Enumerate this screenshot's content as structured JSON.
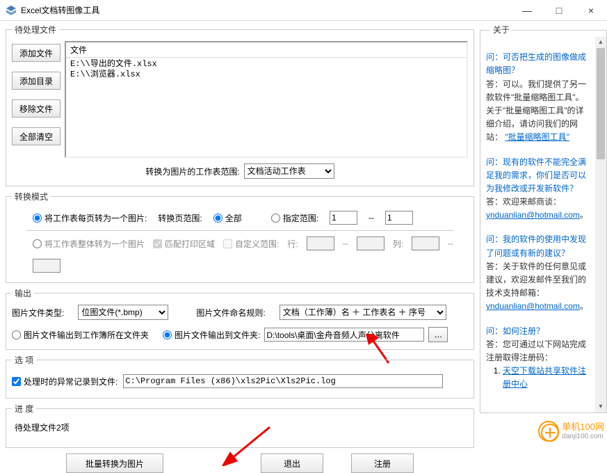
{
  "window": {
    "title": "Excel文档转图像工具",
    "minimize": "—",
    "maximize": "□",
    "close": "×"
  },
  "pending": {
    "legend": "待处理文件",
    "add_file": "添加文件",
    "add_dir": "添加目录",
    "remove": "移除文件",
    "clear": "全部清空",
    "col_header": "文件",
    "rows": [
      "E:\\\\导出的文件.xlsx",
      "E:\\\\浏览器.xlsx"
    ],
    "range_label": "转换为图片的工作表范围:",
    "range_value": "文档活动工作表"
  },
  "mode": {
    "legend": "转换模式",
    "per_page": "将工作表每页转为一个图片:",
    "page_range_label": "转换页范围:",
    "opt_all": "全部",
    "opt_range": "指定范围:",
    "range_from": "1",
    "range_dash": "--",
    "range_to": "1",
    "whole_sheet": "将工作表整体转为一个图片",
    "match_print": "匹配打印区域",
    "custom_range": "自定义范围:",
    "row_label": "行:",
    "col_label": "列:",
    "r1": "",
    "r2": "",
    "c1": "",
    "c2": ""
  },
  "output": {
    "legend": "输出",
    "filetype_label": "图片文件类型:",
    "filetype_value": "位图文件(*.bmp)",
    "naming_label": "图片文件命名规则:",
    "naming_value": "文档（工作薄）名 ＋ 工作表名 ＋ 序号",
    "to_workbook_dir": "图片文件输出到工作簿所在文件夹",
    "to_folder": "图片文件输出到文件夹:",
    "folder_path": "D:\\tools\\桌面\\金舟音频人声分离软件",
    "browse": "..."
  },
  "options": {
    "legend": "选  项",
    "log_label": "处理时的异常记录到文件:",
    "log_path": "C:\\Program Files (x86)\\xls2Pic\\Xls2Pic.log"
  },
  "progress": {
    "legend": "进  度",
    "text": "待处理文件2项"
  },
  "buttons": {
    "convert": "批量转换为图片",
    "exit": "退出",
    "register": "注册"
  },
  "about": {
    "legend": "关于",
    "q1": "问：可否把生成的图像做成缩略图？",
    "a1a": "答：可以。我们提供了另一款软件\"批量缩略图工具\"。 关于\"批量缩略图工具\"的详细介绍，请访问我们的网站：",
    "a1_link": "\"批量缩略图工具\"",
    "q2": "问：现有的软件不能完全满足我的需求，你们是否可以为我修改或开发新软件？",
    "a2a": "答：欢迎来邮商谈：",
    "a2_link": "ynduanlian@hotmail.com",
    "q3": "问：我的软件的使用中发现了问题或有新的建议？",
    "a3a": "答：关于软件的任何意见或建议，欢迎发邮件至我们的技术支持邮箱：",
    "a3_link": "ynduanlian@hotmail.com",
    "q4": "问：如何注册？",
    "a4a": "答：您可通过以下网站完成注册取得注册码：",
    "a4_item1": "天空下载站共享软件注册中心"
  },
  "watermark": {
    "line1": "单机100网",
    "line2": "danji100.com"
  }
}
